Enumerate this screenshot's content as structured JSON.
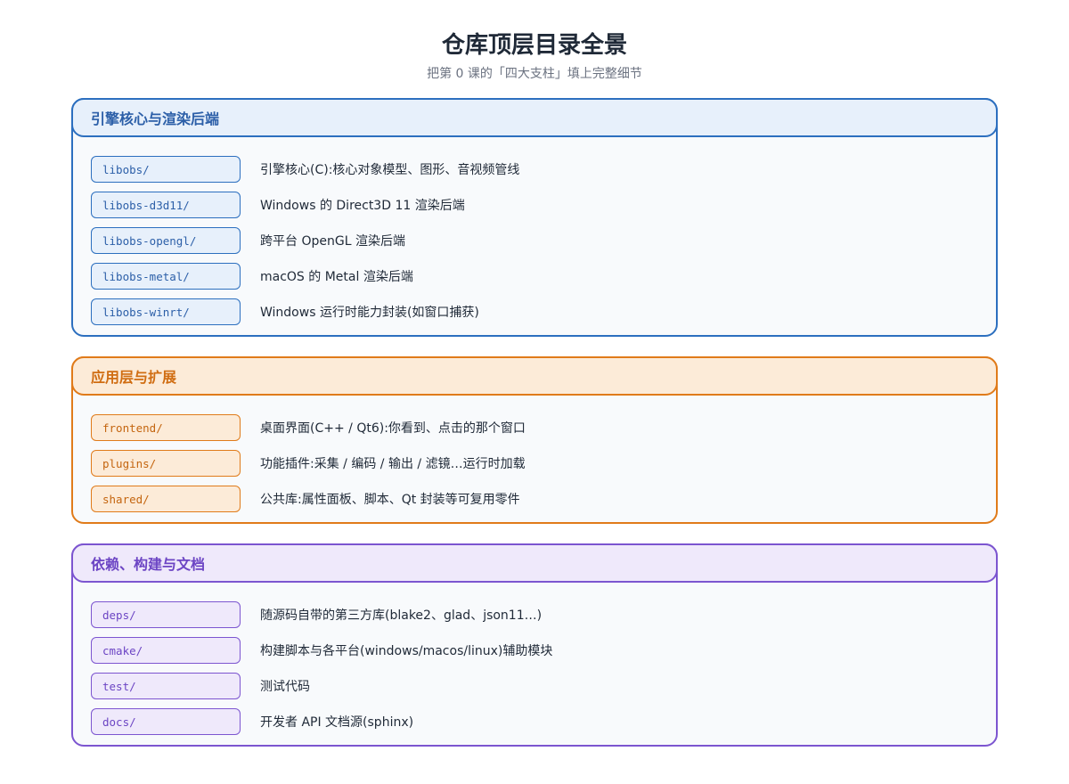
{
  "header": {
    "title": "仓库顶层目录全景",
    "subtitle": "把第 0 课的「四大支柱」填上完整细节"
  },
  "groups": [
    {
      "title": "引擎核心与渲染后端",
      "color": "#2c6fbf",
      "items": [
        {
          "dir": "libobs/",
          "desc": "引擎核心(C):核心对象模型、图形、音视频管线"
        },
        {
          "dir": "libobs-d3d11/",
          "desc": "Windows 的 Direct3D 11 渲染后端"
        },
        {
          "dir": "libobs-opengl/",
          "desc": "跨平台 OpenGL 渲染后端"
        },
        {
          "dir": "libobs-metal/",
          "desc": "macOS 的 Metal 渲染后端"
        },
        {
          "dir": "libobs-winrt/",
          "desc": "Windows 运行时能力封装(如窗口捕获)"
        }
      ]
    },
    {
      "title": "应用层与扩展",
      "color": "#e07b1a",
      "items": [
        {
          "dir": "frontend/",
          "desc": "桌面界面(C++ / Qt6):你看到、点击的那个窗口"
        },
        {
          "dir": "plugins/",
          "desc": "功能插件:采集 / 编码 / 输出 / 滤镜…运行时加载"
        },
        {
          "dir": "shared/",
          "desc": "公共库:属性面板、脚本、Qt 封装等可复用零件"
        }
      ]
    },
    {
      "title": "依赖、构建与文档",
      "color": "#7c55d0",
      "items": [
        {
          "dir": "deps/",
          "desc": "随源码自带的第三方库(blake2、glad、json11…)"
        },
        {
          "dir": "cmake/",
          "desc": "构建脚本与各平台(windows/macos/linux)辅助模块"
        },
        {
          "dir": "test/",
          "desc": "测试代码"
        },
        {
          "dir": "docs/",
          "desc": "开发者 API 文档源(sphinx)"
        }
      ]
    }
  ]
}
